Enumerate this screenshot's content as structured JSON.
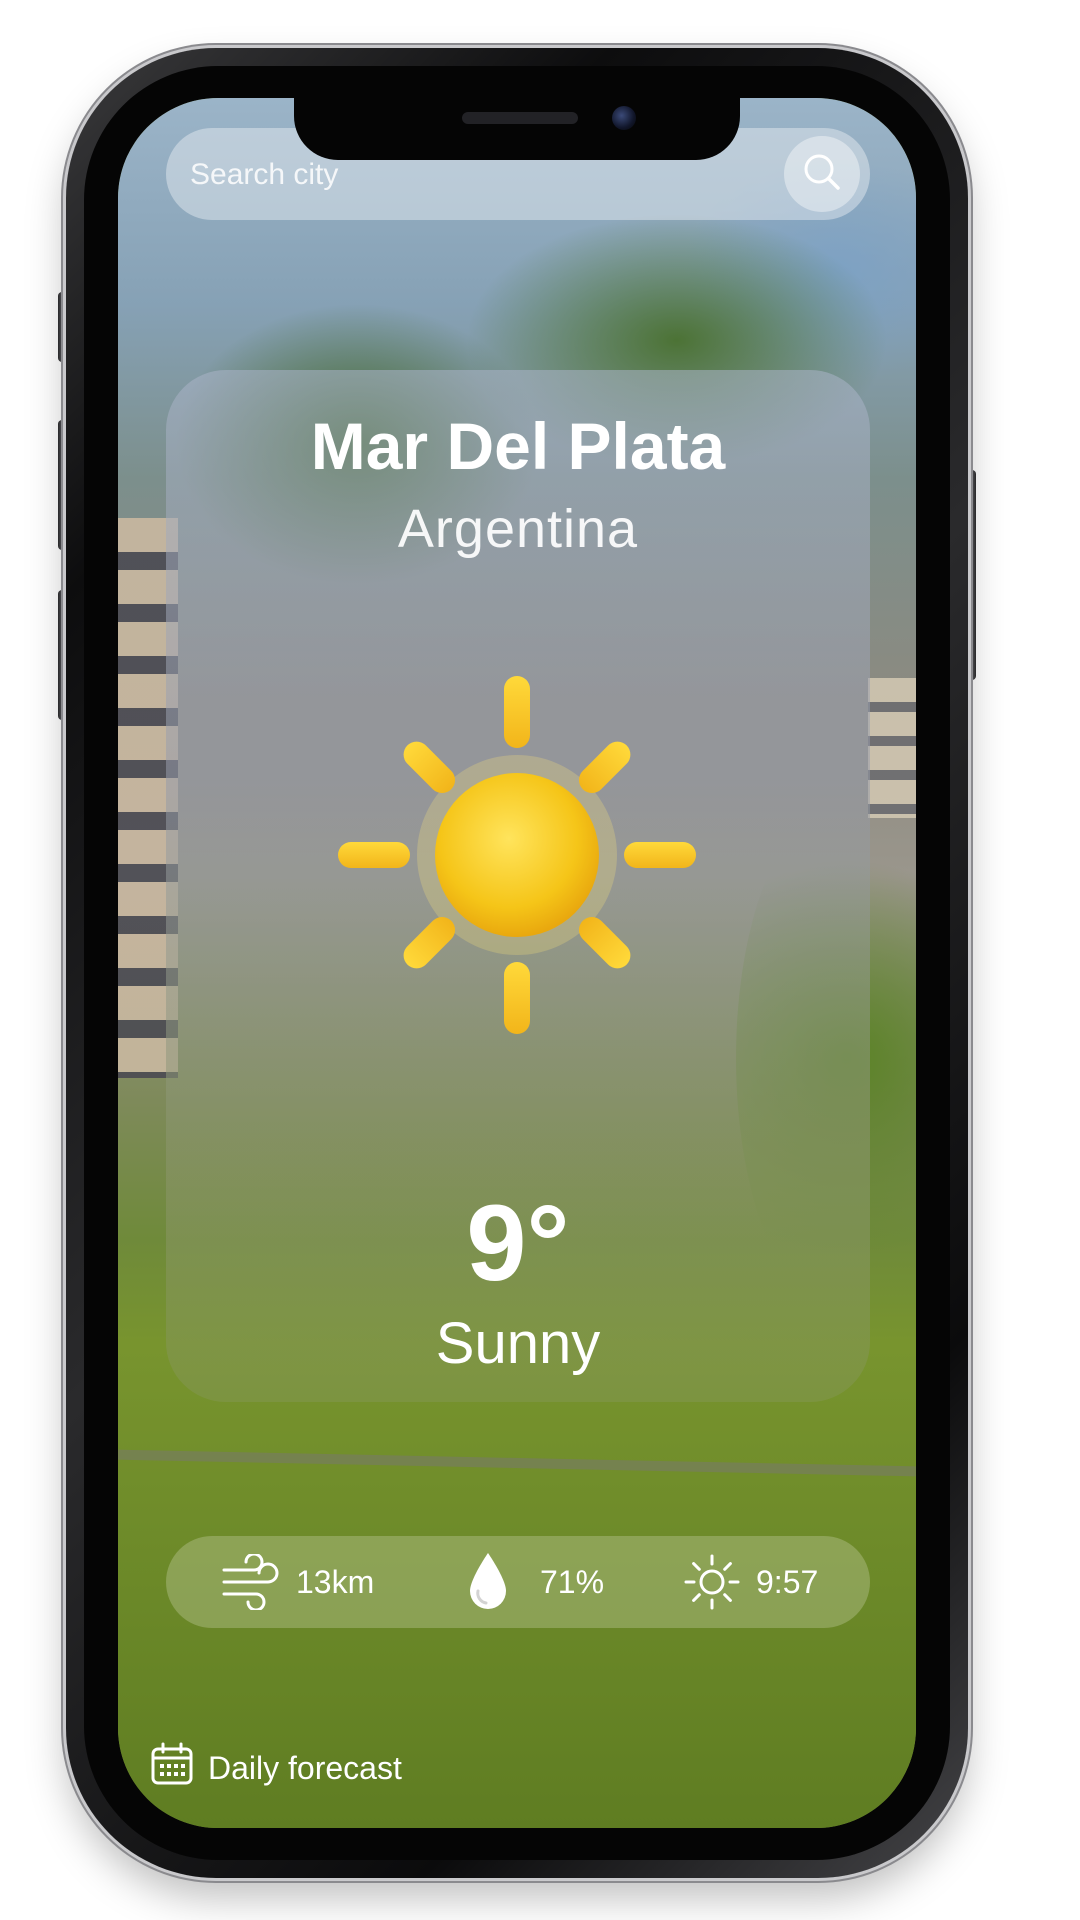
{
  "search": {
    "placeholder": "Search city",
    "icon": "search-icon"
  },
  "location": {
    "city": "Mar Del Plata",
    "country": "Argentina"
  },
  "current": {
    "icon": "sun-icon",
    "temperature": "9°",
    "condition": "Sunny"
  },
  "stats": {
    "wind": {
      "icon": "wind-icon",
      "value": "13km"
    },
    "humidity": {
      "icon": "water-drop-icon",
      "value": "71%"
    },
    "sunrise": {
      "icon": "sun-outline-icon",
      "value": "9:57"
    }
  },
  "footer": {
    "daily_forecast_label": "Daily forecast",
    "icon": "calendar-icon"
  },
  "colors": {
    "sun": "#F5C518",
    "text": "#FFFFFF"
  }
}
